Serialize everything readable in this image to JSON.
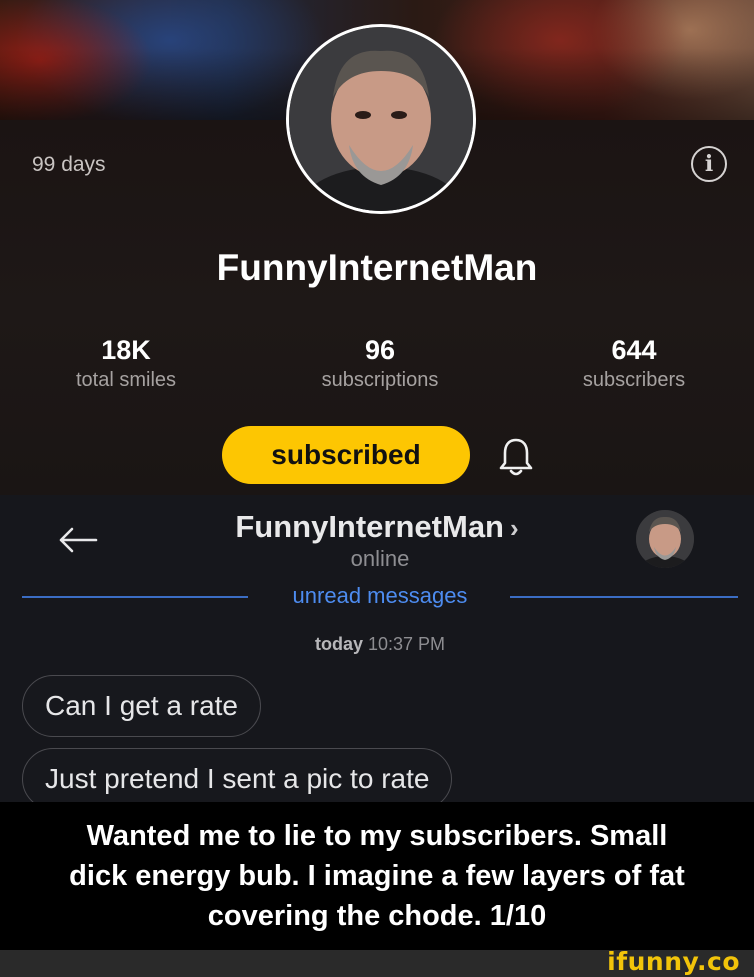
{
  "profile": {
    "days_label": "99 days",
    "username": "FunnyInternetMan",
    "stats": [
      {
        "value": "18K",
        "label": "total smiles"
      },
      {
        "value": "96",
        "label": "subscriptions"
      },
      {
        "value": "644",
        "label": "subscribers"
      }
    ],
    "subscribe_button": "subscribed",
    "accent_color": "#fdc602"
  },
  "chat": {
    "name": "FunnyInternetMan",
    "chevron": "›",
    "status": "online",
    "unread_label": "unread messages",
    "timestamp_day": "today",
    "timestamp_time": "10:37 PM",
    "messages": [
      {
        "text": "Can I get a rate"
      },
      {
        "text": "Just pretend I sent a pic to rate"
      }
    ],
    "link_color": "#4d8cf0"
  },
  "caption": {
    "lines": [
      "Wanted me to lie to my subscribers. Small",
      "dick energy bub. I imagine a few layers of fat",
      "covering the chode. 1/10"
    ]
  },
  "watermark": "ifunny.co"
}
